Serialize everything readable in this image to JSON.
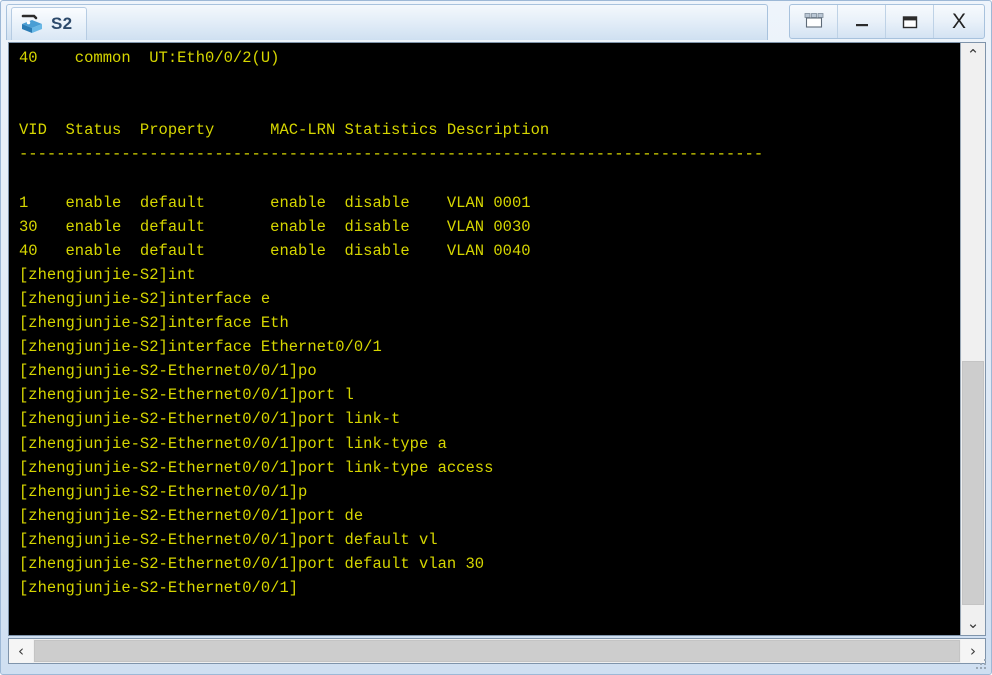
{
  "window": {
    "tab_title": "S2",
    "device_icon": "switch-icon",
    "buttons": [
      {
        "name": "restore-all-windows-button",
        "glyph": "windows-cascade-icon",
        "label": ""
      },
      {
        "name": "minimize-button",
        "glyph": "minimize-icon",
        "label": ""
      },
      {
        "name": "maximize-button",
        "glyph": "maximize-icon",
        "label": ""
      },
      {
        "name": "close-button",
        "glyph": "close-icon",
        "label": "X"
      }
    ]
  },
  "terminal": {
    "foreground_color": "#d6d600",
    "background_color": "#000000",
    "lines": [
      "40    common  UT:Eth0/0/2(U)",
      "",
      "",
      "VID  Status  Property      MAC-LRN Statistics Description",
      "--------------------------------------------------------------------------------",
      "",
      "1    enable  default       enable  disable    VLAN 0001",
      "30   enable  default       enable  disable    VLAN 0030",
      "40   enable  default       enable  disable    VLAN 0040",
      "[zhengjunjie-S2]int",
      "[zhengjunjie-S2]interface e",
      "[zhengjunjie-S2]interface Eth",
      "[zhengjunjie-S2]interface Ethernet0/0/1",
      "[zhengjunjie-S2-Ethernet0/0/1]po",
      "[zhengjunjie-S2-Ethernet0/0/1]port l",
      "[zhengjunjie-S2-Ethernet0/0/1]port link-t",
      "[zhengjunjie-S2-Ethernet0/0/1]port link-type a",
      "[zhengjunjie-S2-Ethernet0/0/1]port link-type access",
      "[zhengjunjie-S2-Ethernet0/0/1]p",
      "[zhengjunjie-S2-Ethernet0/0/1]port de",
      "[zhengjunjie-S2-Ethernet0/0/1]port default vl",
      "[zhengjunjie-S2-Ethernet0/0/1]port default vlan 30",
      "[zhengjunjie-S2-Ethernet0/0/1]"
    ],
    "vlan_table": {
      "headers": [
        "VID",
        "Status",
        "Property",
        "MAC-LRN",
        "Statistics",
        "Description"
      ],
      "rows": [
        [
          "1",
          "enable",
          "default",
          "enable",
          "disable",
          "VLAN 0001"
        ],
        [
          "30",
          "enable",
          "default",
          "enable",
          "disable",
          "VLAN 0030"
        ],
        [
          "40",
          "enable",
          "default",
          "enable",
          "disable",
          "VLAN 0040"
        ]
      ]
    },
    "port_line": "40    common  UT:Eth0/0/2(U)"
  },
  "scrollbars": {
    "vertical": {
      "up_arrow": "⌃",
      "down_arrow": "⌄"
    },
    "horizontal": {
      "left_arrow": "‹",
      "right_arrow": "›"
    }
  }
}
